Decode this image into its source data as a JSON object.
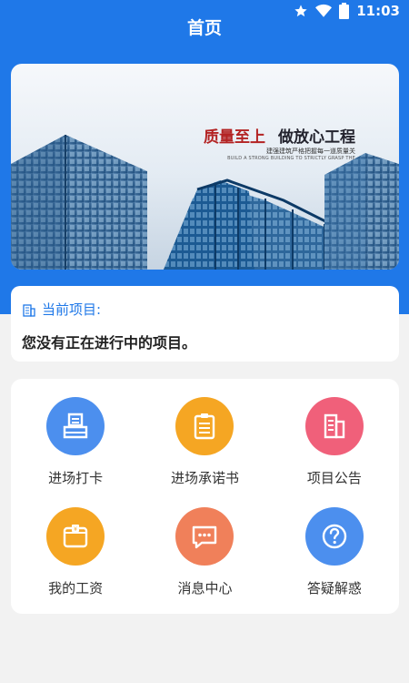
{
  "status_bar": {
    "time": "11:03"
  },
  "header": {
    "title": "首页"
  },
  "banner": {
    "slogan_part1": "质量至上",
    "slogan_part2": "做放心工程",
    "subtitle_cn": "建强建筑严格把握每一道质量关",
    "subtitle_en": "BUILD A STRONG BUILDING TO STRICTLY GRASP THE"
  },
  "project": {
    "label": "当前项目:",
    "value": "您没有正在进行中的项目。"
  },
  "menu": [
    {
      "label": "进场打卡",
      "icon": "clock-in-icon",
      "color": "#4c8fee"
    },
    {
      "label": "进场承诺书",
      "icon": "clipboard-icon",
      "color": "#f5a623"
    },
    {
      "label": "项目公告",
      "icon": "building-icon",
      "color": "#f0607a"
    },
    {
      "label": "我的工资",
      "icon": "wallet-icon",
      "color": "#f5a623"
    },
    {
      "label": "消息中心",
      "icon": "message-icon",
      "color": "#f0805a"
    },
    {
      "label": "答疑解惑",
      "icon": "question-icon",
      "color": "#4c8fee"
    }
  ],
  "colors": {
    "primary": "#1f78e8",
    "background": "#f2f2f2"
  }
}
